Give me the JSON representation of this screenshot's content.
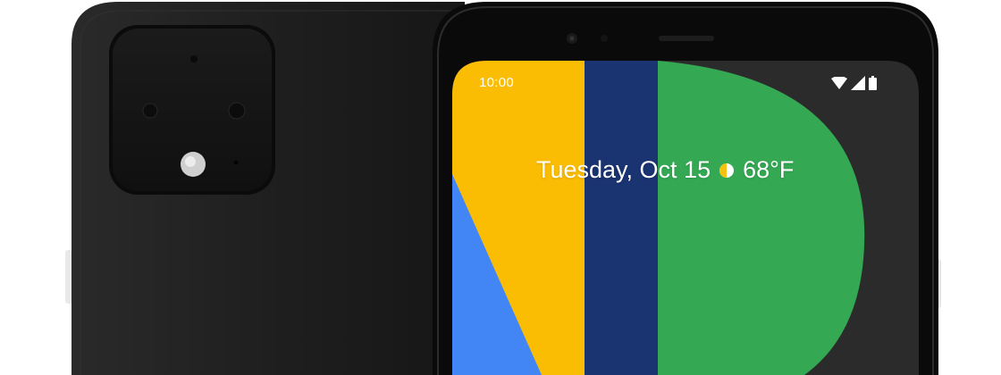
{
  "status_bar": {
    "time": "10:00",
    "icons": [
      "wifi-icon",
      "cellular-signal-icon",
      "battery-icon"
    ]
  },
  "at_a_glance": {
    "date": "Tuesday, Oct 15",
    "weather_icon": "partly-sunny-icon",
    "temperature": "68°F"
  },
  "colors": {
    "phone_body": "#1e1e1e",
    "bezel": "#0c0c0c",
    "wallpaper_yellow": "#fbbc04",
    "wallpaper_navy": "#1a3371",
    "wallpaper_green": "#34a853",
    "wallpaper_blue": "#4285f4",
    "screen_background": "#2b2b2b"
  }
}
